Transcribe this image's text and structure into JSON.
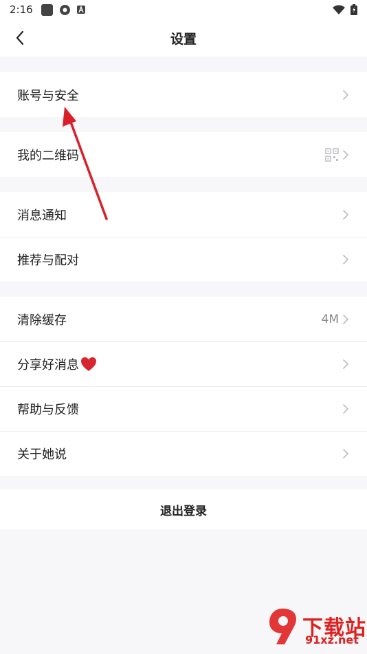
{
  "status_bar": {
    "time": "2:16"
  },
  "header": {
    "title": "设置",
    "back_icon": "chevron-left-icon"
  },
  "groups": [
    {
      "items": [
        {
          "label": "账号与安全",
          "value": ""
        }
      ]
    },
    {
      "items": [
        {
          "label": "我的二维码",
          "value": "",
          "icon": "qr-code-icon"
        }
      ]
    },
    {
      "items": [
        {
          "label": "消息通知",
          "value": ""
        },
        {
          "label": "推荐与配对",
          "value": ""
        }
      ]
    },
    {
      "items": [
        {
          "label": "清除缓存",
          "value": "4M"
        },
        {
          "label": "分享好消息",
          "value": "",
          "icon": "heart-icon"
        },
        {
          "label": "帮助与反馈",
          "value": ""
        },
        {
          "label": "关于她说",
          "value": ""
        }
      ]
    }
  ],
  "logout": {
    "label": "退出登录"
  },
  "watermark": {
    "brand": "下载站",
    "url": "91xz.net"
  },
  "colors": {
    "annotation_arrow": "#d9202a",
    "background": "#f7f7f9",
    "surface": "#ffffff"
  }
}
